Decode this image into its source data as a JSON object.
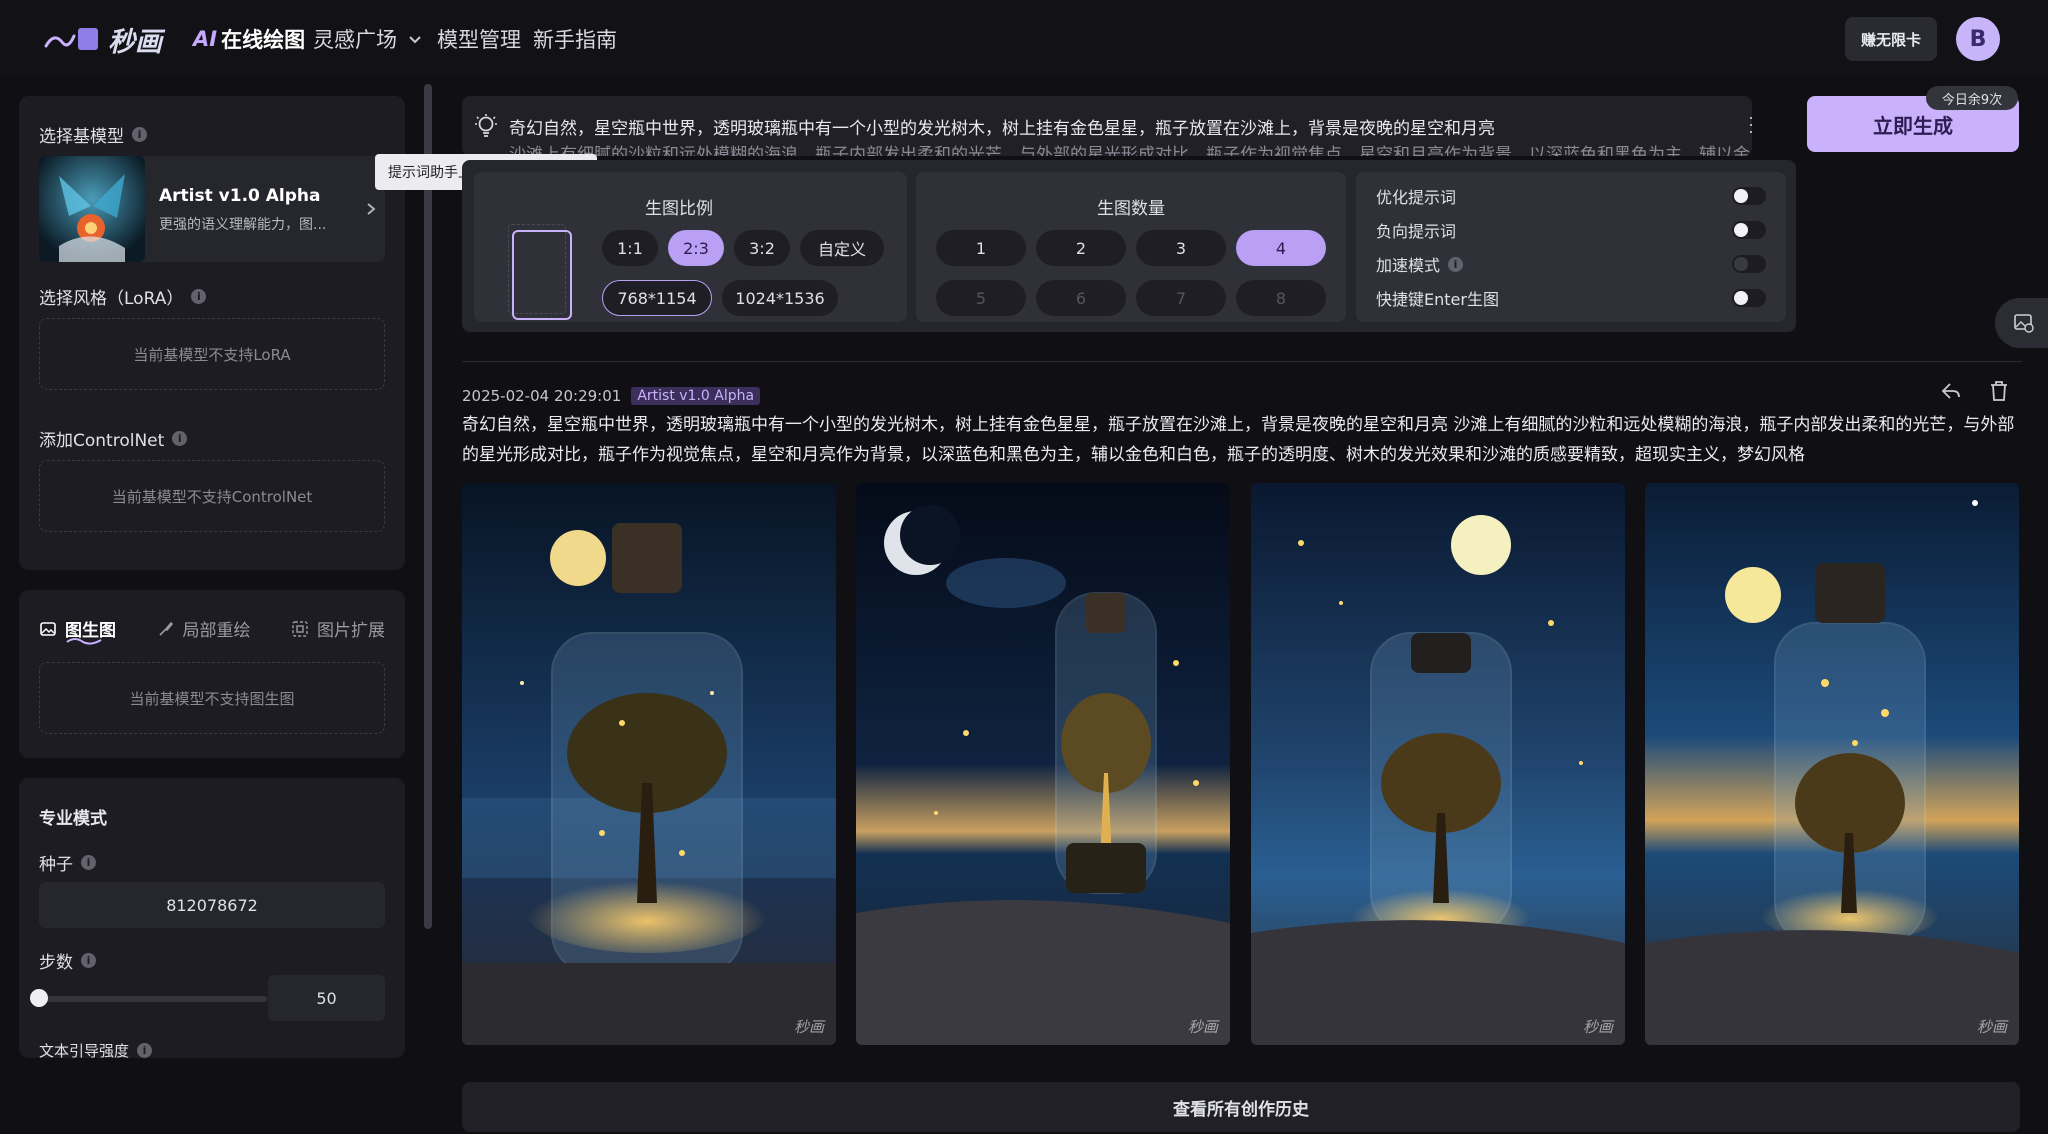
{
  "brand": {
    "name": "秒画"
  },
  "nav": {
    "online_draw_ai": "AI",
    "online_draw": "在线绘图",
    "inspiration": "灵感广场",
    "models": "模型管理",
    "guide": "新手指南"
  },
  "header": {
    "vip_label": "赚无限卡",
    "avatar_letter": "B"
  },
  "sidebar": {
    "base_model_title": "选择基模型",
    "model_name": "Artist v1.0 Alpha",
    "model_desc": "更强的语义理解能力，图...",
    "lora_title": "选择风格（LoRA）",
    "lora_empty": "当前基模型不支持LoRA",
    "controlnet_title": "添加ControlNet",
    "controlnet_empty": "当前基模型不支持ControlNet",
    "tabs": [
      "图生图",
      "局部重绘",
      "图片扩展"
    ],
    "img2img_empty": "当前基模型不支持图生图",
    "pro_title": "专业模式",
    "seed_label": "种子",
    "seed_value": "812078672",
    "steps_label": "步数",
    "steps_value": "50",
    "steps_fraction": 0.0,
    "guidance_label": "文本引导强度"
  },
  "prompt": {
    "line1": "奇幻自然，星空瓶中世界，透明玻璃瓶中有一个小型的发光树木，树上挂有金色星星，瓶子放置在沙滩上，背景是夜晚的星空和月亮",
    "line2": "沙滩上有细腻的沙粒和远处模糊的海浪，瓶子内部发出柔和的光芒，与外部的星光形成对比，瓶子作为视觉焦点，星空和月亮作为背景，以深蓝色和黑色为主，辅以金",
    "tooltip": "提示词助手上线啦，快来体验吧",
    "generate": "立即生成",
    "quota": "今日余9次"
  },
  "options": {
    "ratio_title": "生图比例",
    "ratios": [
      "1:1",
      "2:3",
      "3:2",
      "自定义"
    ],
    "ratio_selected": "2:3",
    "sizes": [
      "768*1154",
      "1024*1536"
    ],
    "size_selected": "768*1154",
    "count_title": "生图数量",
    "counts": [
      "1",
      "2",
      "3",
      "4",
      "5",
      "6",
      "7",
      "8"
    ],
    "count_selected": "4",
    "toggles": [
      {
        "label": "优化提示词",
        "on": false
      },
      {
        "label": "负向提示词",
        "on": false
      },
      {
        "label": "加速模式",
        "on": false,
        "disabled": true
      },
      {
        "label": "快捷键Enter生图",
        "on": false
      }
    ]
  },
  "result": {
    "timestamp": "2025-02-04 20:29:01",
    "model_badge": "Artist v1.0 Alpha",
    "full_prompt": "奇幻自然，星空瓶中世界，透明玻璃瓶中有一个小型的发光树木，树上挂有金色星星，瓶子放置在沙滩上，背景是夜晚的星空和月亮 沙滩上有细腻的沙粒和远处模糊的海浪，瓶子内部发出柔和的光芒，与外部的星光形成对比，瓶子作为视觉焦点，星空和月亮作为背景，以深蓝色和黑色为主，辅以金色和白色，瓶子的透明度、树木的发光效果和沙滩的质感要精致，超现实主义，梦幻风格",
    "watermark": "秒画",
    "history_button": "查看所有创作历史"
  },
  "colors": {
    "accent": "#c9b1fb",
    "bg": "#101014",
    "panel": "#1c1c22"
  }
}
